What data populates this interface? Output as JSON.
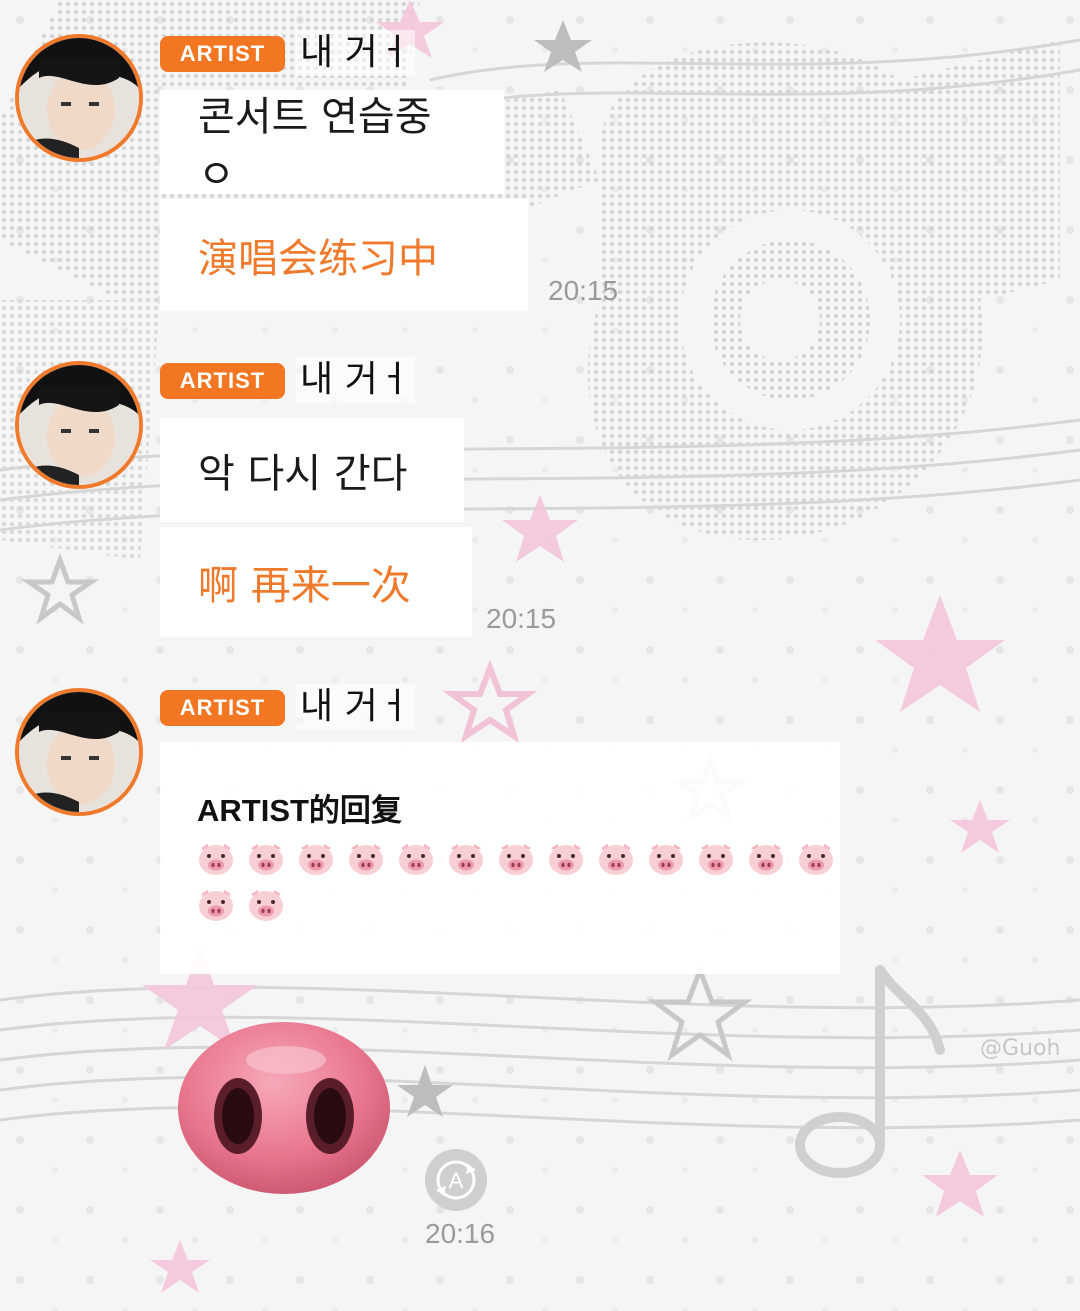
{
  "colors": {
    "accent": "#f37622",
    "translation_text": "#f07a2c",
    "timestamp": "#9a9a9a",
    "bubble": "#ffffff"
  },
  "messages": [
    {
      "badge": "ARTIST",
      "sender": "내 거ㅓ",
      "text": "콘서트 연습중ㅇ",
      "translation": "演唱会练习中",
      "time": "20:15"
    },
    {
      "badge": "ARTIST",
      "sender": "내 거ㅓ",
      "text": "악 다시 간다",
      "translation": "啊 再来一次",
      "time": "20:15"
    },
    {
      "badge": "ARTIST",
      "sender": "내 거ㅓ",
      "reply_title": "ARTIST的回复",
      "reply_emoji": "🐷",
      "reply_emoji_count": 15,
      "sticker": "pig-snout",
      "time": "20:16"
    }
  ],
  "icons": {
    "avatar": "avatar-photo",
    "resend": "resend-circle-icon"
  }
}
